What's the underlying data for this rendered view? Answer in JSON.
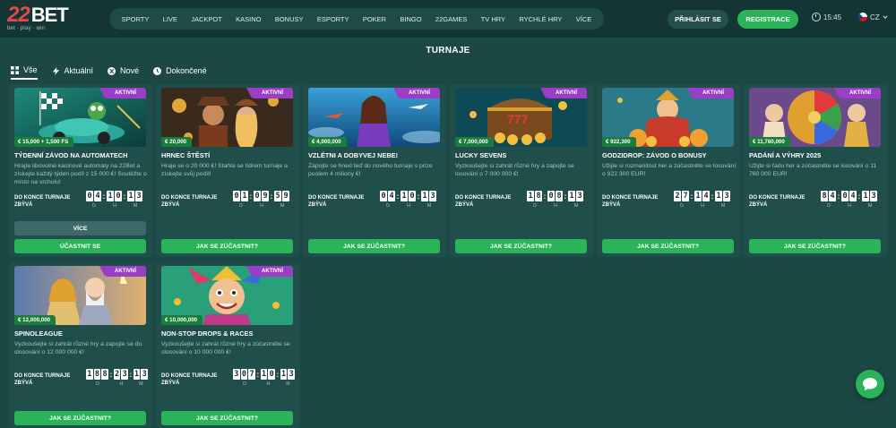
{
  "brand": {
    "logo_main": "BET",
    "logo_num": "22",
    "logo_sub": "bet · play · win"
  },
  "nav": [
    {
      "label": "SPORTY",
      "name": "nav-sporty"
    },
    {
      "label": "LIVE",
      "name": "nav-live"
    },
    {
      "label": "JACKPOT",
      "name": "nav-jackpot"
    },
    {
      "label": "KASINO",
      "name": "nav-kasino"
    },
    {
      "label": "BONUSY",
      "name": "nav-bonusy"
    },
    {
      "label": "ESPORTY",
      "name": "nav-esporty"
    },
    {
      "label": "POKER",
      "name": "nav-poker"
    },
    {
      "label": "BINGO",
      "name": "nav-bingo"
    },
    {
      "label": "22GAMES",
      "name": "nav-22games"
    },
    {
      "label": "TV HRY",
      "name": "nav-tv-hry"
    },
    {
      "label": "RYCHLÉ HRY",
      "name": "nav-rychle-hry"
    },
    {
      "label": "VÍCE",
      "name": "nav-vice"
    }
  ],
  "header": {
    "login": "PŘIHLÁSIT SE",
    "register": "REGISTRACE",
    "time": "15:45",
    "lang": "CZ"
  },
  "page": {
    "title": "TURNAJE"
  },
  "tabs": [
    {
      "label": "Vše",
      "icon": "grid-icon"
    },
    {
      "label": "Aktuální",
      "icon": "lightning-icon"
    },
    {
      "label": "Nové",
      "icon": "new-icon"
    },
    {
      "label": "Dokončené",
      "icon": "clock-icon"
    }
  ],
  "countdown_label": "DO KONCE TURNAJE ZBÝVÁ",
  "units": [
    "D",
    "H",
    "M"
  ],
  "badge": "AKTIVNÍ",
  "buttons": {
    "more": "VÍCE",
    "join_first": "ÚČASTNIT SE",
    "join": "JAK SE ZÚČASTNIT?"
  },
  "colors": {
    "accent": "#2bb35a",
    "badge": "#9b3ec6",
    "prize": "#1a7d3b",
    "bg": "#1b4845"
  },
  "cards": [
    {
      "title": "TÝDENNÍ ZÁVOD NA AUTOMATECH",
      "prize": "€ 15,000 + 1,500 FS",
      "desc": "Hrajte libovolné kasinové automaty na 22Bet a získejte každý týden podíl z 15 000 €! Soutěžte o místo na vrcholu!",
      "digits": [
        "0",
        "4",
        "1",
        "0",
        "1",
        "3"
      ]
    },
    {
      "title": "HRNEC ŠTĚSTÍ",
      "prize": "€ 20,000",
      "desc": "Hraje se o 20 000 €! Staňte se lídrem turnaje a získejte svůj podíl!",
      "digits": [
        "0",
        "1",
        "0",
        "9",
        "5",
        "9"
      ]
    },
    {
      "title": "VZLÉTNI A DOBYVEJ NEBE!",
      "prize": "€ 4,000,000",
      "desc": "Zapojte se hned teď do nového turnaje s prize poolem 4 miliony €!",
      "digits": [
        "0",
        "4",
        "1",
        "0",
        "1",
        "3"
      ]
    },
    {
      "title": "LUCKY SEVENS",
      "prize": "€ 7,000,000",
      "desc": "Vyzkoušejte si zahrát různé hry a zapojte se losování o 7 000 000 €!",
      "digits": [
        "1",
        "8",
        "0",
        "8",
        "1",
        "3"
      ]
    },
    {
      "title": "GODZIDROP: ZÁVOD O BONUSY",
      "prize": "€ 922,300",
      "desc": "Užijte si rozmanitost her a zúčastněte se losování o 922 300 EUR!",
      "digits": [
        "2",
        "7",
        "1",
        "4",
        "1",
        "3"
      ]
    },
    {
      "title": "PADÁNÍ A VÝHRY 2025",
      "prize": "€ 11,760,000",
      "desc": "Užijte si řadu her a zúčastněte se losování o 11 760 000 EUR!",
      "digits": [
        "8",
        "4",
        "0",
        "4",
        "1",
        "3"
      ]
    },
    {
      "title": "SPINOLEAGUE",
      "prize": "€ 12,000,000",
      "desc": "Vyzkoušejte si zahrát různé hry a zapojte se do slosování o 12 000 000 €!",
      "digits": [
        "1",
        "8",
        "8",
        "2",
        "3",
        "1",
        "3"
      ]
    },
    {
      "title": "NON-STOP DROPS & RACES",
      "prize": "€ 10,000,000",
      "desc": "Vyzkoušejte si zahrát různé hry a zúčastněte se slosování o 10 000 000 €!",
      "digits": [
        "3",
        "0",
        "7",
        "1",
        "0",
        "1",
        "3"
      ]
    }
  ]
}
